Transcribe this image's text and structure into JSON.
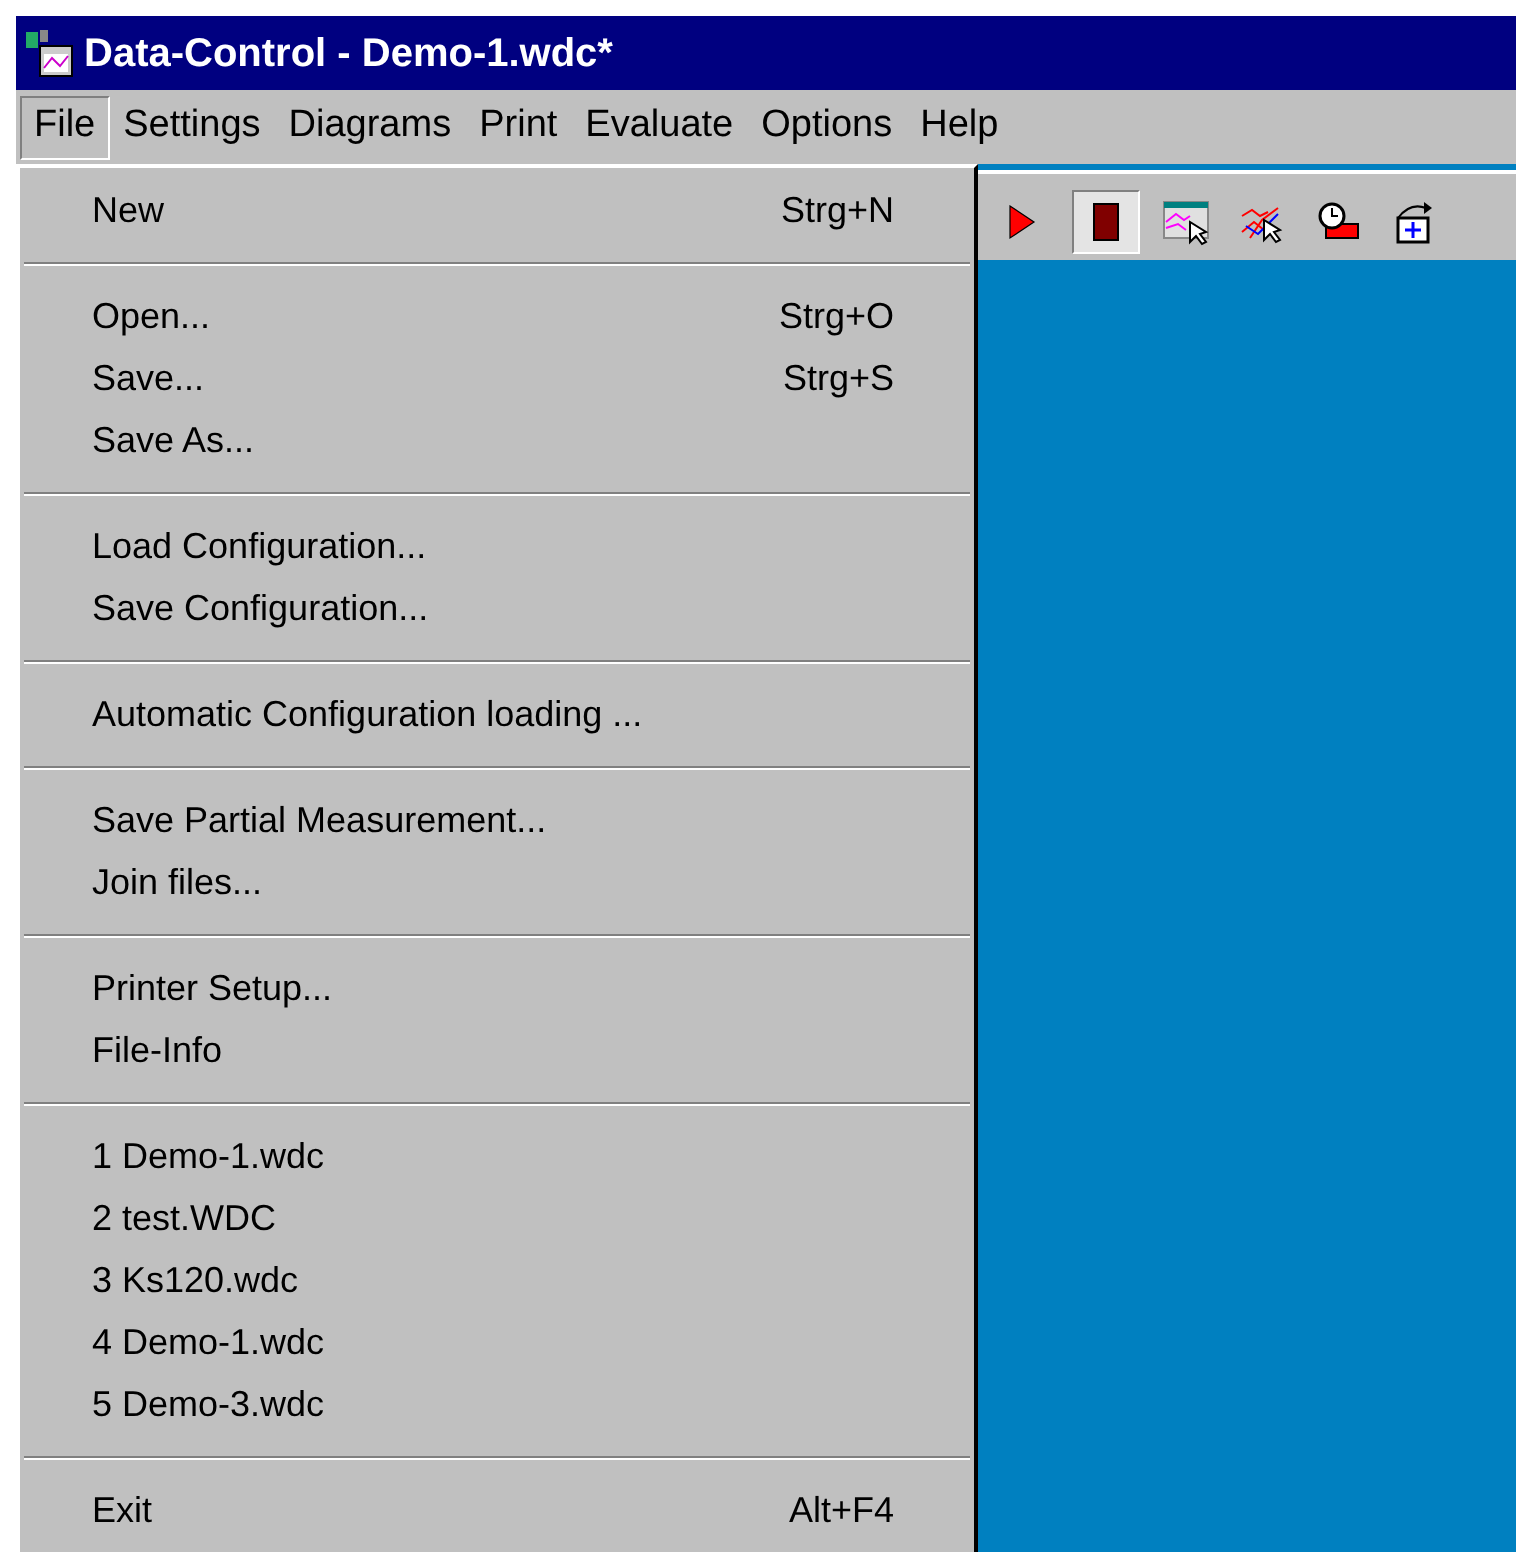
{
  "window": {
    "title": "Data-Control - Demo-1.wdc*"
  },
  "menu_bar": [
    {
      "label": "File",
      "selected": true
    },
    {
      "label": "Settings",
      "selected": false
    },
    {
      "label": "Diagrams",
      "selected": false
    },
    {
      "label": "Print",
      "selected": false
    },
    {
      "label": "Evaluate",
      "selected": false
    },
    {
      "label": "Options",
      "selected": false
    },
    {
      "label": "Help",
      "selected": false
    }
  ],
  "toolbar": [
    {
      "kind": "play",
      "pressed": false
    },
    {
      "kind": "stop",
      "pressed": true
    },
    {
      "kind": "chart-cursor",
      "pressed": false
    },
    {
      "kind": "curves-cursor",
      "pressed": false
    },
    {
      "kind": "timer",
      "pressed": false
    },
    {
      "kind": "add",
      "pressed": false
    }
  ],
  "file_menu": [
    [
      {
        "label": "New",
        "shortcut": "Strg+N"
      }
    ],
    [
      {
        "label": "Open...",
        "shortcut": "Strg+O"
      },
      {
        "label": "Save...",
        "shortcut": "Strg+S"
      },
      {
        "label": "Save As..."
      }
    ],
    [
      {
        "label": "Load Configuration..."
      },
      {
        "label": "Save Configuration..."
      }
    ],
    [
      {
        "label": "Automatic Configuration loading ..."
      }
    ],
    [
      {
        "label": "Save Partial Measurement..."
      },
      {
        "label": "Join files..."
      }
    ],
    [
      {
        "label": "Printer Setup..."
      },
      {
        "label": "File-Info"
      }
    ],
    [
      {
        "label": "1 Demo-1.wdc"
      },
      {
        "label": "2 test.WDC"
      },
      {
        "label": "3 Ks120.wdc"
      },
      {
        "label": "4 Demo-1.wdc"
      },
      {
        "label": "5 Demo-3.wdc"
      }
    ],
    [
      {
        "label": "Exit",
        "shortcut": "Alt+F4"
      }
    ]
  ]
}
